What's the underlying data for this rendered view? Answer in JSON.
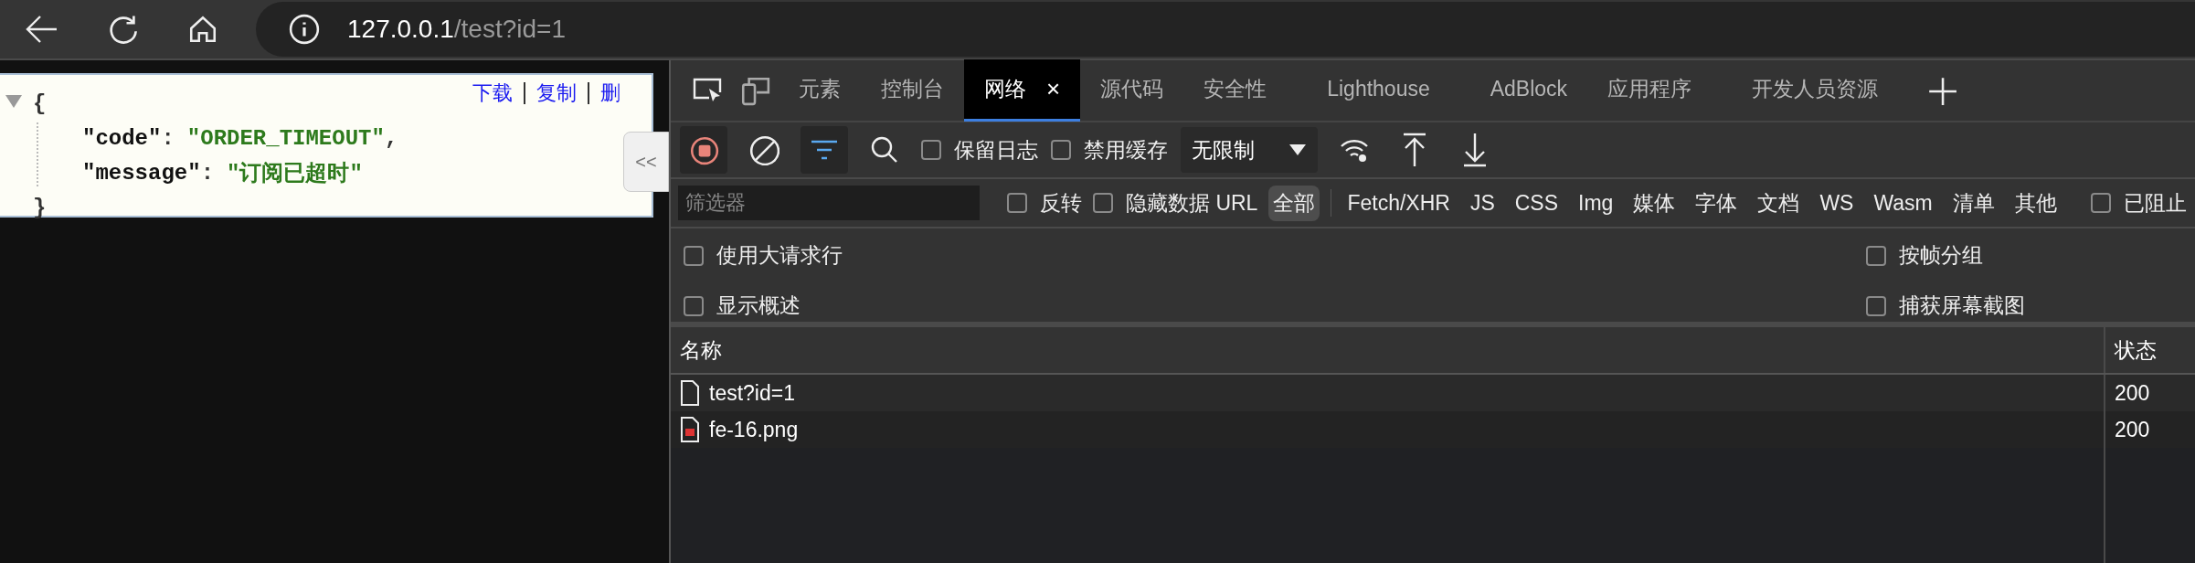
{
  "browser": {
    "url_host": "127.0.0.1",
    "url_path": "/test?id=1"
  },
  "page": {
    "actions": [
      "下载",
      "复制",
      "删"
    ],
    "collapse_button": "<<",
    "json": {
      "open": "{",
      "close": "}",
      "expanded": true,
      "entries": [
        {
          "key": "\"code\"",
          "sep": ":",
          "value": "\"ORDER_TIMEOUT\"",
          "comma": ","
        },
        {
          "key": "\"message\"",
          "sep": ":",
          "value": "\"订阅已超时\""
        }
      ]
    }
  },
  "devtools": {
    "tabs": [
      {
        "label": "元素",
        "selected": false
      },
      {
        "label": "控制台",
        "selected": false
      },
      {
        "label": "网络",
        "selected": true,
        "close": "×"
      },
      {
        "label": "源代码",
        "selected": false
      },
      {
        "label": "安全性",
        "selected": false
      },
      {
        "label": "Lighthouse",
        "selected": false
      },
      {
        "label": "AdBlock",
        "selected": false
      },
      {
        "label": "应用程序",
        "selected": false
      },
      {
        "label": "开发人员资源",
        "selected": false
      }
    ],
    "toolbar": {
      "recording": true,
      "filter_active": true,
      "checkboxes": [
        {
          "label": "保留日志",
          "checked": false
        },
        {
          "label": "禁用缓存",
          "checked": false
        }
      ],
      "throttling": "无限制"
    },
    "filter": {
      "placeholder": "筛选器",
      "checkboxes": [
        {
          "label": "反转",
          "checked": false
        },
        {
          "label": "隐藏数据 URL",
          "checked": false
        }
      ],
      "types": [
        {
          "label": "全部",
          "selected": true
        },
        {
          "label": "Fetch/XHR",
          "selected": false
        },
        {
          "label": "JS",
          "selected": false
        },
        {
          "label": "CSS",
          "selected": false
        },
        {
          "label": "Img",
          "selected": false
        },
        {
          "label": "媒体",
          "selected": false
        },
        {
          "label": "字体",
          "selected": false
        },
        {
          "label": "文档",
          "selected": false
        },
        {
          "label": "WS",
          "selected": false
        },
        {
          "label": "Wasm",
          "selected": false
        },
        {
          "label": "清单",
          "selected": false
        },
        {
          "label": "其他",
          "selected": false
        }
      ],
      "blocked": {
        "label": "已阻止",
        "checked": false
      }
    },
    "settings": {
      "left": [
        {
          "label": "使用大请求行",
          "checked": false
        },
        {
          "label": "显示概述",
          "checked": false
        }
      ],
      "right": [
        {
          "label": "按帧分组",
          "checked": false
        },
        {
          "label": "捕获屏幕截图",
          "checked": false
        }
      ]
    },
    "table": {
      "columns": [
        "名称",
        "状态"
      ],
      "rows": [
        {
          "kind": "document",
          "name": "test?id=1",
          "status": "200"
        },
        {
          "kind": "image",
          "name": "fe-16.png",
          "status": "200"
        }
      ]
    }
  }
}
